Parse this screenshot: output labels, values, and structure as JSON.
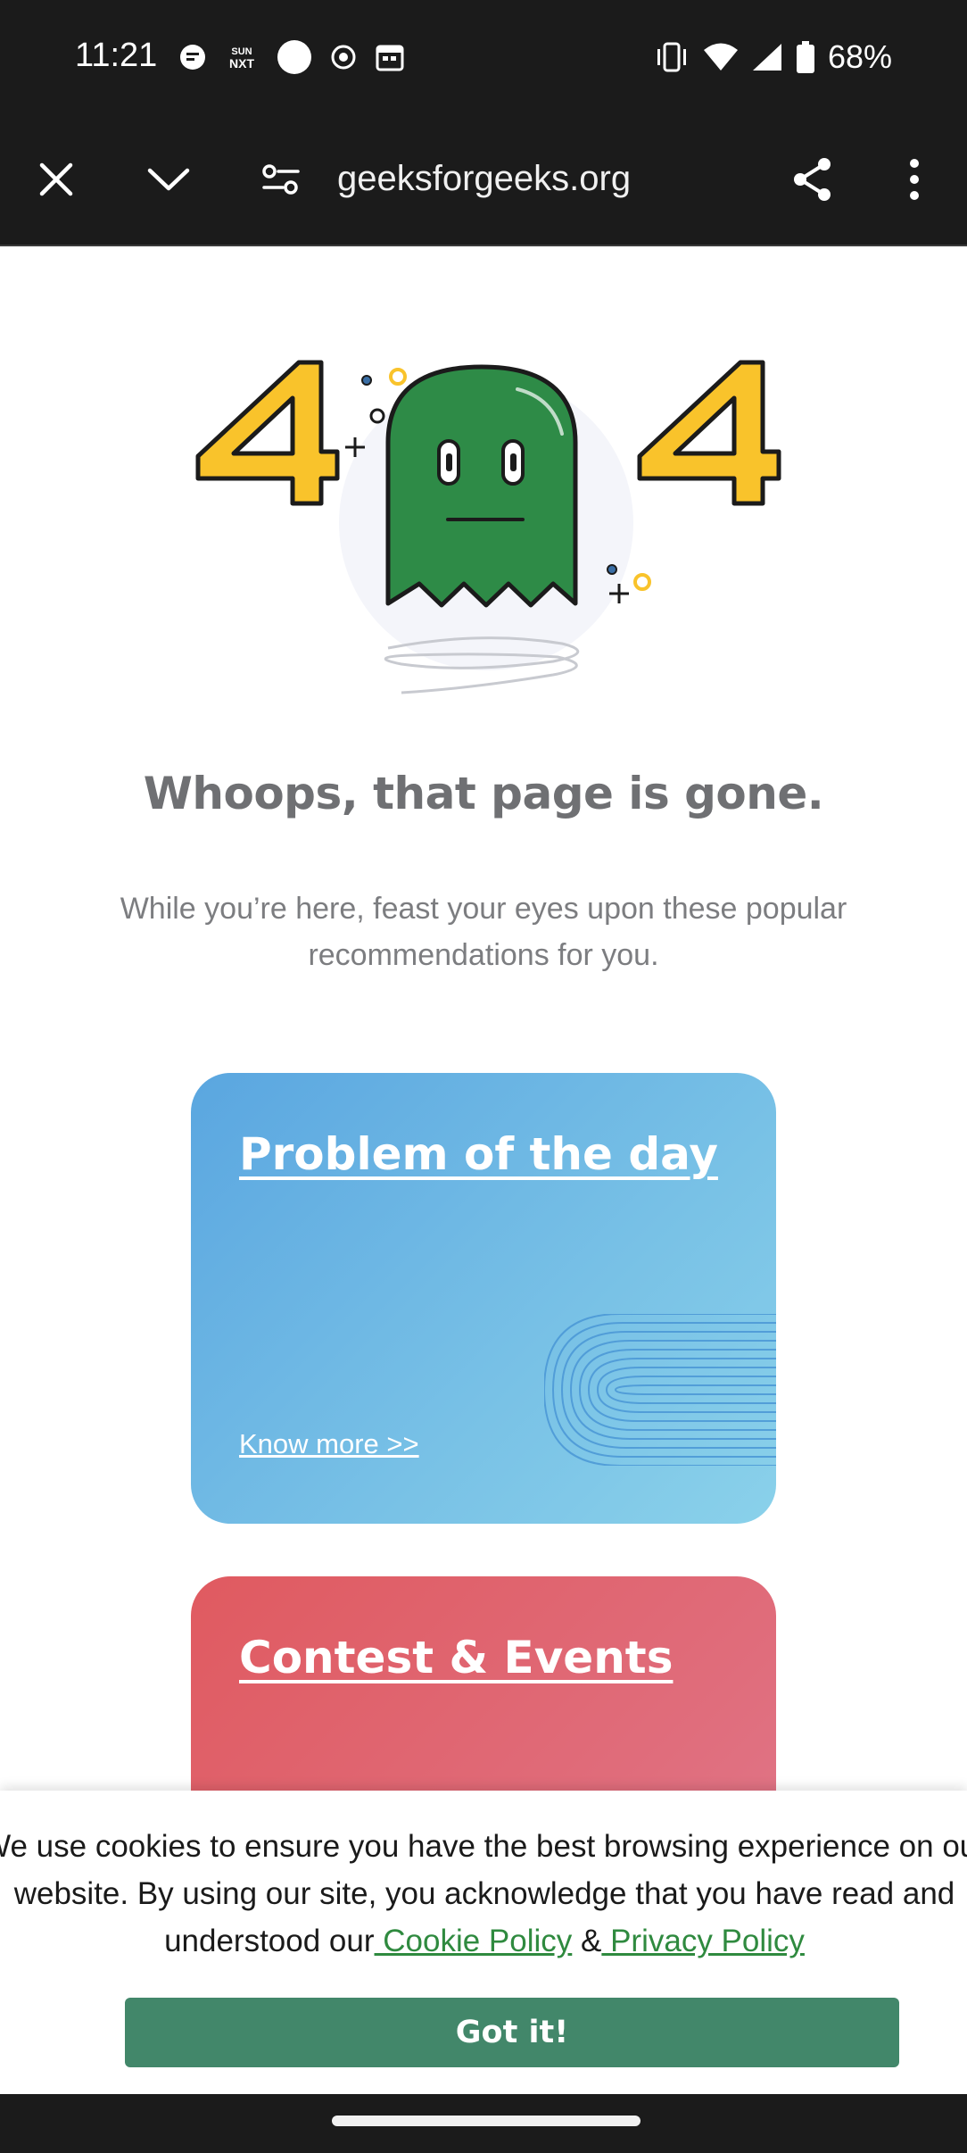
{
  "status_bar": {
    "time": "11:21",
    "battery": "68%",
    "left_icons": [
      "chat-notification-icon",
      "sun-nxt-icon",
      "circle-icon",
      "record-icon",
      "calendar-icon"
    ],
    "right_icons": [
      "vibrate-icon",
      "wifi-icon",
      "cell-signal-icon",
      "battery-icon"
    ]
  },
  "browser": {
    "url": "geeksforgeeks.org",
    "icons": [
      "close-icon",
      "chevron-down-icon",
      "site-settings-icon",
      "share-icon",
      "more-options-icon"
    ]
  },
  "page": {
    "headline": "Whoops, that page is gone.",
    "subtext": "While you’re here, feast your eyes upon these popular recommendations for you.",
    "cards": [
      {
        "title": "Problem of the day",
        "link": "Know more >>",
        "color": "#5aa6e0"
      },
      {
        "title": "Contest & Events",
        "color": "#e05a60"
      }
    ]
  },
  "cookie_banner": {
    "text": "We use cookies to ensure you have the best browsing experience on our website. By using our site, you acknowledge that you have read and understood our",
    "cookie_policy": " Cookie Policy",
    "amp": " &",
    "privacy_policy": " Privacy Policy",
    "button": "Got it!",
    "button_color": "#42876a",
    "link_color": "#2f8a3f"
  },
  "colors": {
    "ghost": "#2e8b47",
    "four_digit": "#f9c32b",
    "bars": "#1b1b1b"
  }
}
